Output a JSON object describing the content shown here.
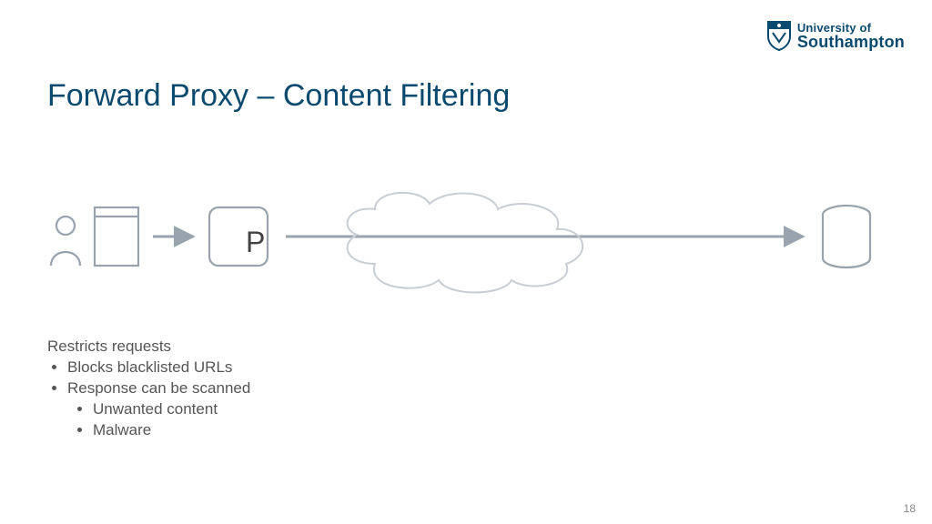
{
  "logo": {
    "line1": "University of",
    "line2": "Southampton"
  },
  "title": "Forward Proxy – Content Filtering",
  "proxy_label": "P",
  "notes": {
    "header": "Restricts requests",
    "bullets": [
      {
        "text": "Blocks blacklisted URLs"
      },
      {
        "text": "Response can be scanned",
        "sub": [
          "Unwanted content",
          "Malware"
        ]
      }
    ]
  },
  "page_number": "18",
  "colors": {
    "accent": "#0b4a6f",
    "stroke": "#98a3ad"
  }
}
